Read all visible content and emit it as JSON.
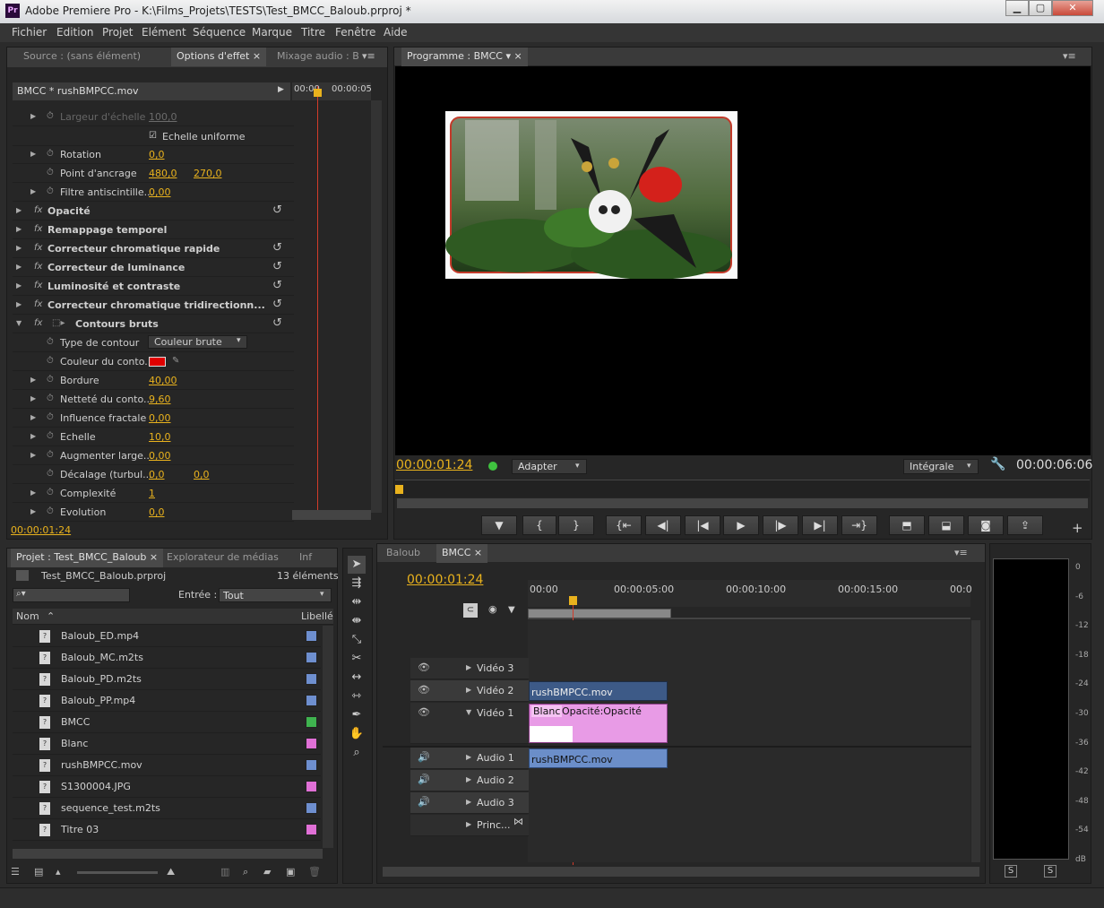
{
  "window": {
    "app_icon": "Pr",
    "title": "Adobe Premiere Pro - K:\\Films_Projets\\TESTS\\Test_BMCC_Baloub.prproj *"
  },
  "menu": [
    "Fichier",
    "Edition",
    "Projet",
    "Elément",
    "Séquence",
    "Marque",
    "Titre",
    "Fenêtre",
    "Aide"
  ],
  "effects_panel": {
    "tabs": [
      "Source : (sans élément)",
      "Options d'effet",
      "Mixage audio : B"
    ],
    "clip_header": "BMCC * rushBMPCC.mov",
    "ruler": [
      "00:00",
      "00:00:05"
    ],
    "rows": [
      {
        "label": "Largeur d'échelle",
        "val1": "100,0",
        "dim": true
      },
      {
        "label": "Echelle uniforme",
        "checkbox": true
      },
      {
        "label": "Rotation",
        "val1": "0,0"
      },
      {
        "label": "Point d'ancrage",
        "val1": "480,0",
        "val2": "270,0"
      },
      {
        "label": "Filtre antiscintille...",
        "val1": "0,00"
      },
      {
        "label": "Opacité",
        "fx": true
      },
      {
        "label": "Remappage temporel",
        "fx": true
      },
      {
        "label": "Correcteur chromatique rapide",
        "fx": true
      },
      {
        "label": "Correcteur de luminance",
        "fx": true
      },
      {
        "label": "Luminosité et contraste",
        "fx": true
      },
      {
        "label": "Correcteur chromatique tridirectionn...",
        "fx": true
      },
      {
        "label": "Contours bruts",
        "fx": true
      },
      {
        "label": "Type de contour",
        "dropdown": "Couleur brute"
      },
      {
        "label": "Couleur du conto...",
        "color": "#e00000"
      },
      {
        "label": "Bordure",
        "val1": "40,00"
      },
      {
        "label": "Netteté du conto...",
        "val1": "9,60"
      },
      {
        "label": "Influence fractale",
        "val1": "0,00"
      },
      {
        "label": "Echelle",
        "val1": "10,0"
      },
      {
        "label": "Augmenter large...",
        "val1": "0,00"
      },
      {
        "label": "Décalage (turbul...",
        "val1": "0,0",
        "val2": "0,0"
      },
      {
        "label": "Complexité",
        "val1": "1"
      },
      {
        "label": "Evolution",
        "val1": "0,0"
      }
    ],
    "timecode": "00:00:01:24"
  },
  "program_monitor": {
    "tab": "Programme : BMCC",
    "timecode": "00:00:01:24",
    "fit": "Adapter",
    "quality": "Intégrale",
    "duration": "00:00:06:06"
  },
  "project_panel": {
    "tabs": [
      "Projet : Test_BMCC_Baloub",
      "Explorateur de médias",
      "Inf"
    ],
    "project_name": "Test_BMCC_Baloub.prproj",
    "count": "13 éléments",
    "entry_label": "Entrée :",
    "entry_value": "Tout",
    "col_name": "Nom",
    "col_label": "Libellé",
    "items": [
      {
        "name": "Baloub_ED.mp4",
        "color": "#6e8fcf"
      },
      {
        "name": "Baloub_MC.m2ts",
        "color": "#6e8fcf"
      },
      {
        "name": "Baloub_PD.m2ts",
        "color": "#6e8fcf"
      },
      {
        "name": "Baloub_PP.mp4",
        "color": "#6e8fcf"
      },
      {
        "name": "BMCC",
        "color": "#3fb34f"
      },
      {
        "name": "Blanc",
        "color": "#e070d6"
      },
      {
        "name": "rushBMPCC.mov",
        "color": "#6e8fcf"
      },
      {
        "name": "S1300004.JPG",
        "color": "#e070d6"
      },
      {
        "name": "sequence_test.m2ts",
        "color": "#6e8fcf"
      },
      {
        "name": "Titre 03",
        "color": "#e070d6"
      }
    ]
  },
  "timeline": {
    "tabs": [
      "Baloub",
      "BMCC"
    ],
    "timecode": "00:00:01:24",
    "ruler": [
      "00:00",
      "00:00:05:00",
      "00:00:10:00",
      "00:00:15:00",
      "00:0"
    ],
    "tracks": [
      "Vidéo 3",
      "Vidéo 2",
      "Vidéo 1",
      "Audio 1",
      "Audio 2",
      "Audio 3",
      "Princ..."
    ],
    "clips": {
      "v2": "rushBMPCC.mov",
      "v1_a": "Blanc",
      "v1_b": "Opacité:Opacité",
      "a1": "rushBMPCC.mov"
    }
  },
  "audio_meter": {
    "scale": [
      "0",
      "-6",
      "-12",
      "-18",
      "-24",
      "-30",
      "-36",
      "-42",
      "-48",
      "-54",
      "dB"
    ],
    "solo": [
      "S",
      "S"
    ]
  },
  "colors": {
    "accent": "#e9b21d",
    "panel": "#262626",
    "clip_video": "#3d5a87",
    "clip_audio": "#6b8ec9",
    "clip_title": "#e89be6"
  }
}
